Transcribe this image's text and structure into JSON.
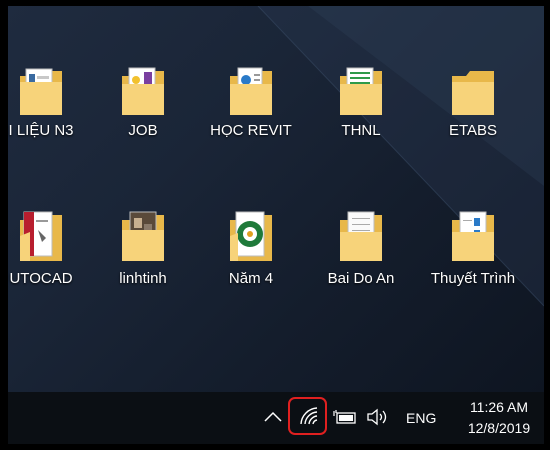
{
  "desktop": {
    "icons": [
      {
        "label": "I LIỆU N3",
        "icon": "folder-icon"
      },
      {
        "label": "JOB",
        "icon": "folder-icon"
      },
      {
        "label": "HỌC REVIT",
        "icon": "folder-icon"
      },
      {
        "label": "THNL",
        "icon": "folder-icon"
      },
      {
        "label": "ETABS",
        "icon": "folder-icon"
      },
      {
        "label": "UTOCAD",
        "icon": "folder-icon"
      },
      {
        "label": "linhtinh",
        "icon": "folder-icon"
      },
      {
        "label": "Năm 4",
        "icon": "folder-icon"
      },
      {
        "label": "Bai Do An",
        "icon": "folder-icon"
      },
      {
        "label": "Thuyết Trình",
        "icon": "folder-icon"
      }
    ]
  },
  "taskbar": {
    "language": "ENG",
    "time": "11:26 AM",
    "date": "12/8/2019",
    "tray_icons": [
      "chevron-up-icon",
      "wifi-icon",
      "battery-icon",
      "volume-icon"
    ]
  },
  "colors": {
    "folder_back": "#e8b84a",
    "folder_front": "#f7d37a",
    "highlight": "#e02020",
    "taskbar": "#0b0f14"
  }
}
